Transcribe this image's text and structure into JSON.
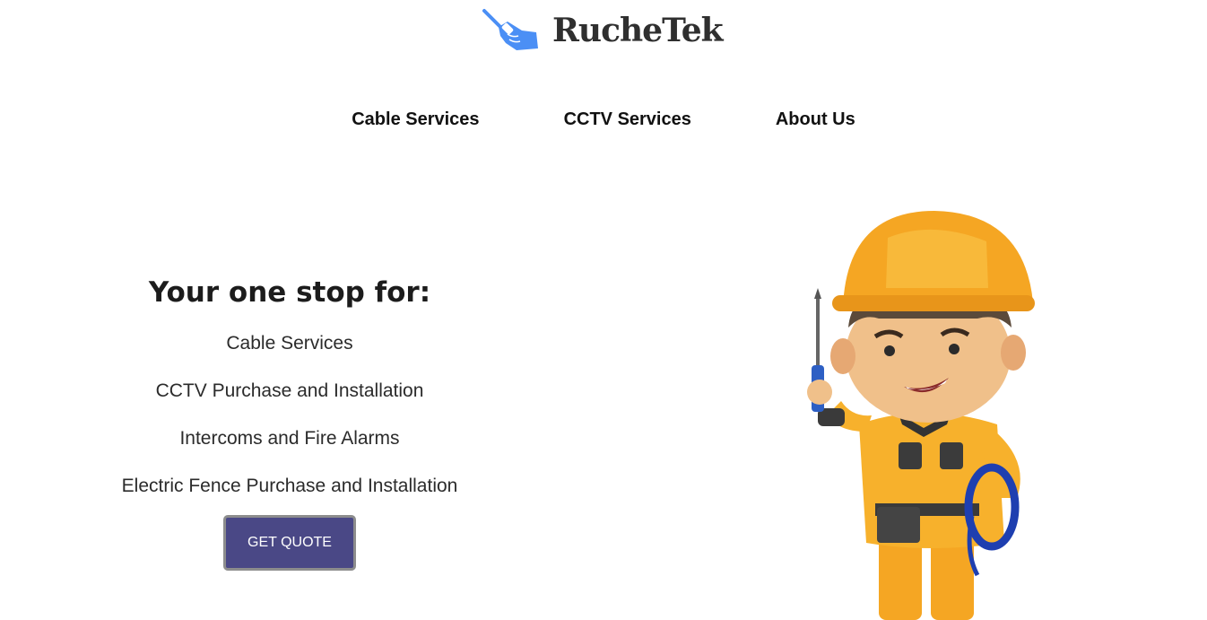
{
  "header": {
    "logo_text": "RucheTek",
    "logo_icon": "screwdriver-hand-icon",
    "brand_color": "#4b8ff5"
  },
  "nav": {
    "items": [
      {
        "label": "Cable Services"
      },
      {
        "label": "CCTV Services"
      },
      {
        "label": "About Us"
      }
    ]
  },
  "hero": {
    "title": "Your one stop for:",
    "services": [
      "Cable Services",
      "CCTV Purchase and Installation",
      "Intercoms and Fire Alarms",
      "Electric Fence Purchase and Installation"
    ],
    "cta_label": "GET QUOTE",
    "cta_color": "#4a4886",
    "illustration": "technician-with-screwdriver-and-cable"
  }
}
